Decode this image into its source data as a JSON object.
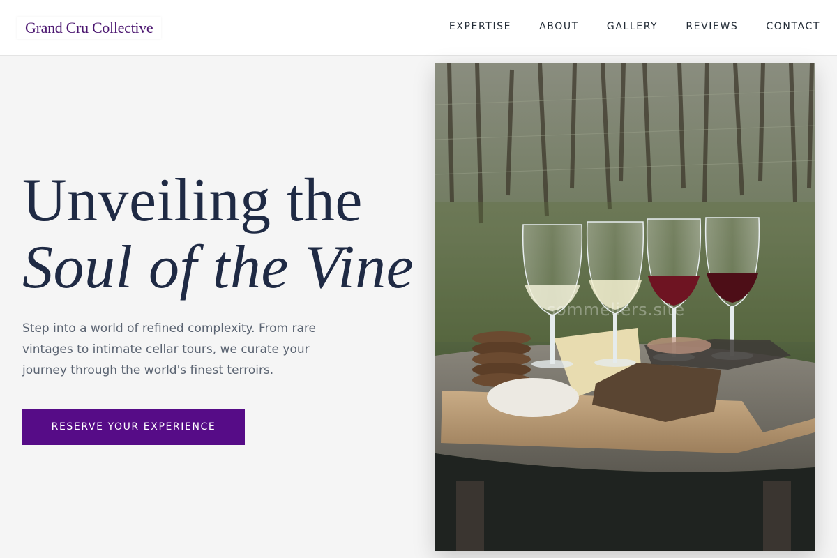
{
  "brand": {
    "name": "Grand Cru Collective",
    "color": "#4b1670"
  },
  "nav": {
    "items": [
      {
        "label": "EXPERTISE"
      },
      {
        "label": "ABOUT"
      },
      {
        "label": "GALLERY"
      },
      {
        "label": "REVIEWS"
      },
      {
        "label": "CONTACT"
      }
    ]
  },
  "hero": {
    "title_line1": "Unveiling the",
    "title_line2": "Soul of the Vine",
    "description": "Step into a world of refined complexity. From rare vintages to intimate cellar tours, we curate your journey through the world's finest terroirs.",
    "cta_label": "RESERVE YOUR EXPERIENCE",
    "cta_color": "#560c87"
  },
  "image": {
    "subject": "wine-tasting-flight-photo",
    "watermark": "sommeliers.site"
  }
}
